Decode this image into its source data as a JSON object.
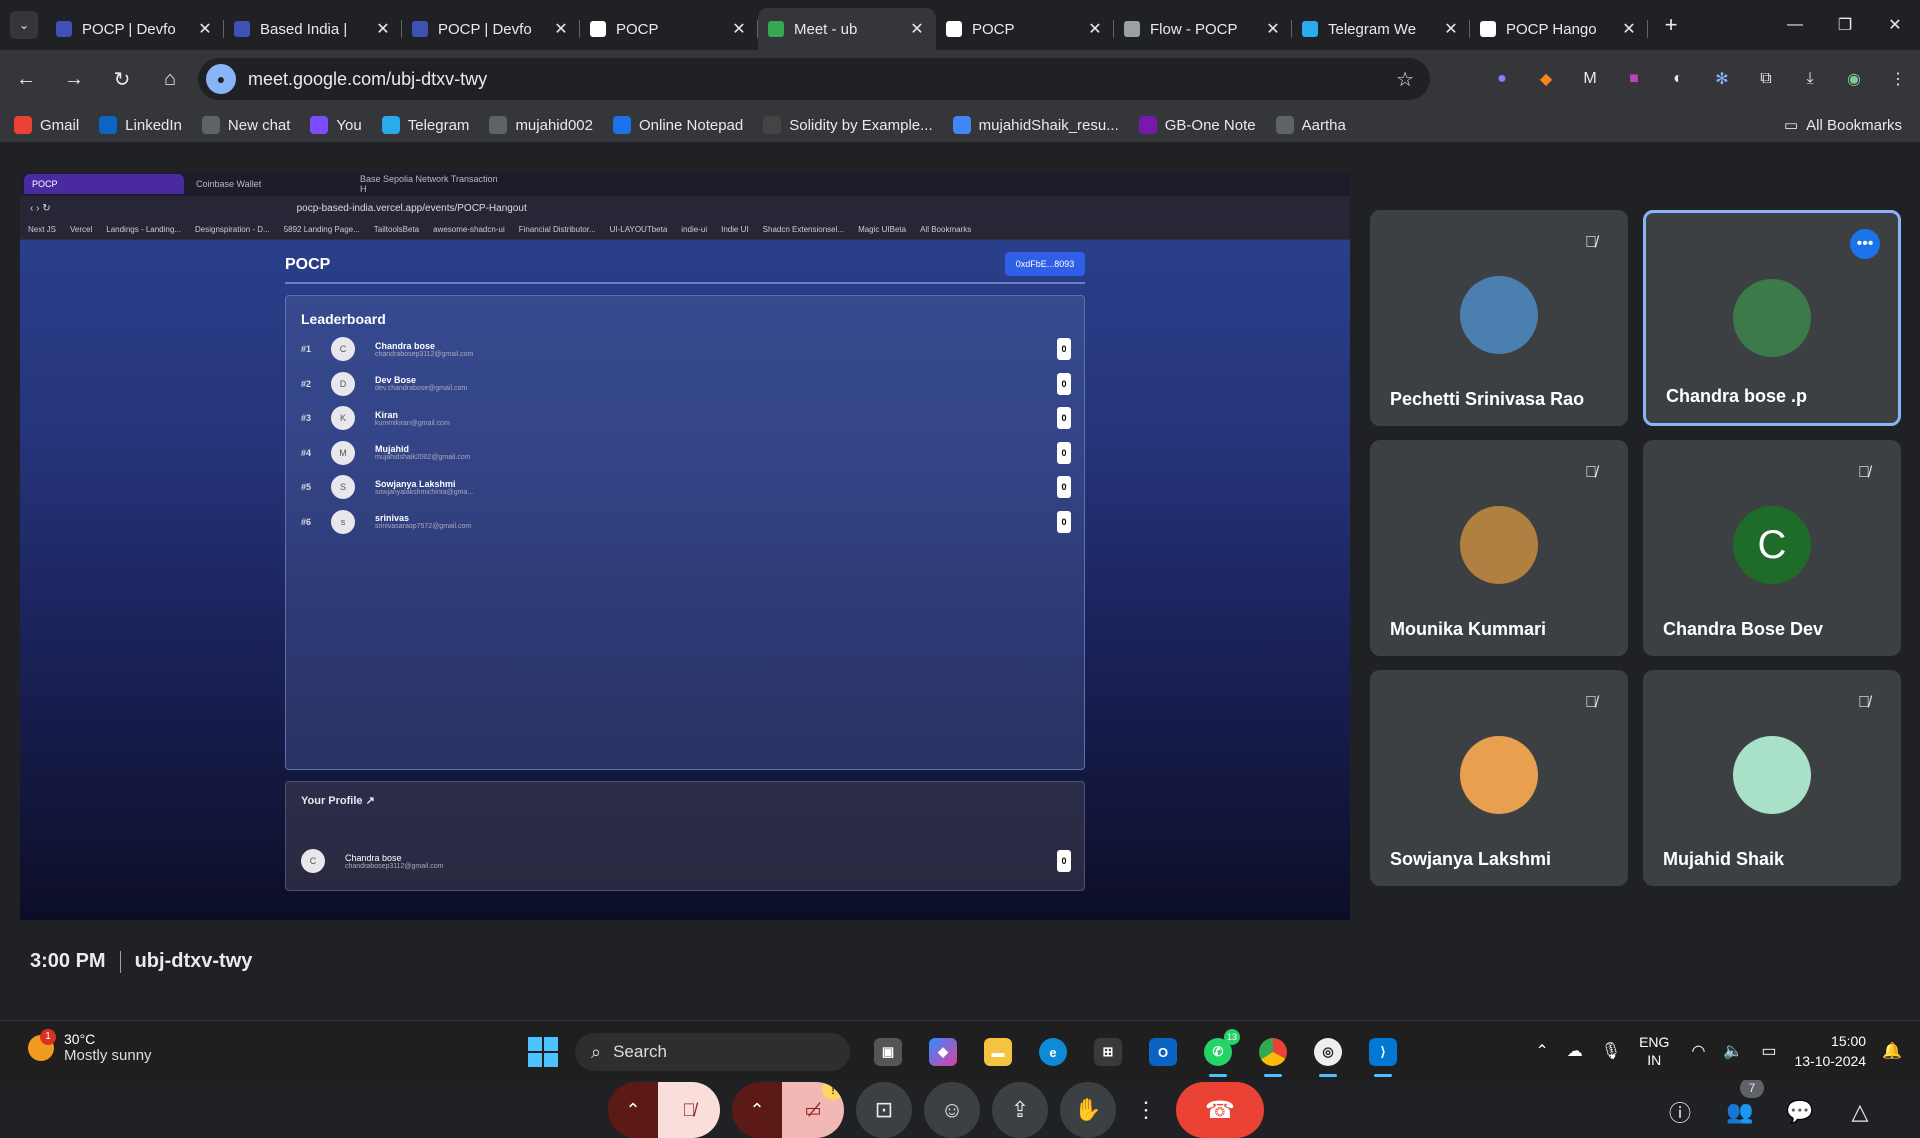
{
  "browser": {
    "tabs": [
      {
        "title": "POCP | Devfo",
        "color": "#3f51b5",
        "active": false
      },
      {
        "title": "Based India |",
        "color": "#3f51b5",
        "active": false
      },
      {
        "title": "POCP | Devfo",
        "color": "#3f51b5",
        "active": false
      },
      {
        "title": "POCP",
        "color": "#ffffff",
        "active": false
      },
      {
        "title": "Meet - ub",
        "color": "#34a853",
        "active": true
      },
      {
        "title": "POCP",
        "color": "#ffffff",
        "active": false
      },
      {
        "title": "Flow - POCP",
        "color": "#9aa0a6",
        "active": false
      },
      {
        "title": "Telegram We",
        "color": "#2aabee",
        "active": false
      },
      {
        "title": "POCP Hango",
        "color": "#ffffff",
        "active": false
      }
    ],
    "url": "meet.google.com/ubj-dtxv-twy",
    "bookmarks": [
      {
        "label": "Gmail",
        "icon": "gmail-icon",
        "color": "#ea4335"
      },
      {
        "label": "LinkedIn",
        "icon": "linkedin-icon",
        "color": "#0a66c2"
      },
      {
        "label": "New chat",
        "icon": "openai-icon",
        "color": "#5f6368"
      },
      {
        "label": "You",
        "icon": "you-icon",
        "color": "#7c4dff"
      },
      {
        "label": "Telegram",
        "icon": "telegram-icon",
        "color": "#2aabee"
      },
      {
        "label": "mujahid002",
        "icon": "github-icon",
        "color": "#5f6368"
      },
      {
        "label": "Online Notepad",
        "icon": "notepad-icon",
        "color": "#1a73e8"
      },
      {
        "label": "Solidity by Example...",
        "icon": "solidity-icon",
        "color": "#444"
      },
      {
        "label": "mujahidShaik_resu...",
        "icon": "docs-icon",
        "color": "#4285f4"
      },
      {
        "label": "GB-One Note",
        "icon": "onenote-icon",
        "color": "#7719aa"
      },
      {
        "label": "Aartha",
        "icon": "notion-icon",
        "color": "#5f6368"
      }
    ],
    "all_bookmarks": "All Bookmarks"
  },
  "presentation": {
    "tabs": [
      "POCP",
      "Coinbase Wallet",
      "Base Sepolia Network Transaction H"
    ],
    "url": "pocp-based-india.vercel.app/events/POCP-Hangout",
    "bookmarks": [
      "Next JS",
      "Vercel",
      "Landings - Landing...",
      "Designspiration - D...",
      "5892 Landing Page...",
      "TailtoolsBeta",
      "awesome-shadcn-ui",
      "Financial Distributor...",
      "UI-LAYOUTbeta",
      "indie-ui",
      "Indie UI",
      "Shadcn Extensionsel...",
      "Magic UIBeta",
      "All Bookmarks"
    ],
    "logo": "POCP",
    "wallet": "0xdFbE...8093",
    "leaderboard_title": "Leaderboard",
    "leaderboard": [
      {
        "rank": "#1",
        "initial": "C",
        "name": "Chandra bose",
        "email": "chandrabosep3112@gmail.com",
        "score": "0"
      },
      {
        "rank": "#2",
        "initial": "D",
        "name": "Dev Bose",
        "email": "dev.chandrabose@gmail.com",
        "score": "0"
      },
      {
        "rank": "#3",
        "initial": "K",
        "name": "Kiran",
        "email": "kummikiran@gmail.com",
        "score": "0"
      },
      {
        "rank": "#4",
        "initial": "M",
        "name": "Mujahid",
        "email": "mujahidshaik2002@gmail.com",
        "score": "0"
      },
      {
        "rank": "#5",
        "initial": "S",
        "name": "Sowjanya Lakshmi",
        "email": "sowjanyalakshmichinta@gma...",
        "score": "0"
      },
      {
        "rank": "#6",
        "initial": "s",
        "name": "srinivas",
        "email": "srinivasaraop7572@gmail.com",
        "score": "0"
      }
    ],
    "profile_title": "Your Profile",
    "profile": {
      "initial": "C",
      "name": "Chandra bose",
      "email": "chandrabosep3112@gmail.com",
      "score": "0"
    }
  },
  "participants": [
    {
      "name": "Pechetti Srinivasa Rao",
      "color": "#4a7fb0",
      "muted": true,
      "active": false,
      "initial": ""
    },
    {
      "name": "Chandra bose .p",
      "color": "#3d7a4a",
      "muted": false,
      "active": true,
      "initial": ""
    },
    {
      "name": "Mounika Kummari",
      "color": "#b08040",
      "muted": true,
      "active": false,
      "initial": ""
    },
    {
      "name": "Chandra Bose Dev",
      "color": "#1e6b2a",
      "muted": true,
      "active": false,
      "initial": "C"
    },
    {
      "name": "Sowjanya Lakshmi",
      "color": "#e8a050",
      "muted": true,
      "active": false,
      "initial": ""
    },
    {
      "name": "Mujahid Shaik",
      "color": "#a8e0c8",
      "muted": true,
      "active": false,
      "initial": ""
    }
  ],
  "meeting": {
    "time": "3:00 PM",
    "code": "ubj-dtxv-twy",
    "people_count": "7"
  },
  "taskbar": {
    "temp": "30°C",
    "weather": "Mostly sunny",
    "weather_badge": "1",
    "search": "Search",
    "whatsapp_badge": "13",
    "lang1": "ENG",
    "lang2": "IN",
    "time": "15:00",
    "date": "13-10-2024"
  }
}
